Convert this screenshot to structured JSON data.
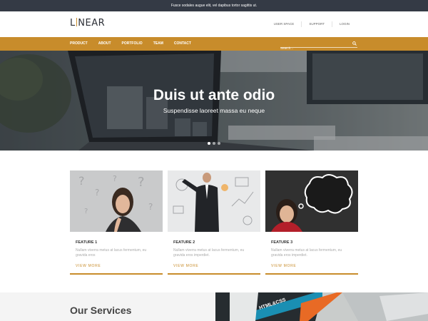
{
  "topbar": {
    "text": "Fusce sodales augue elit, vel dapibus tortor sagittis ut."
  },
  "header": {
    "logo": {
      "left": "L",
      "right": "NEAR"
    },
    "utility_links": [
      "USER SPACE",
      "SUPPORT",
      "LOGIN"
    ]
  },
  "nav": {
    "items": [
      "PRODUCT",
      "ABOUT",
      "PORTFOLIO",
      "TEAM",
      "CONTACT"
    ],
    "search_placeholder": "Search..."
  },
  "hero": {
    "title": "Duis ut ante odio",
    "subtitle": "Suspendisse laoreet massa eu neque",
    "slides": 3,
    "active_slide": 1
  },
  "features": [
    {
      "title": "FEATURE 1",
      "text": "Nullam viverra metus at lacus fermentum, eu gravida eros",
      "more": "VIEW MORE"
    },
    {
      "title": "FEATURE 2",
      "text": "Nullam viverra metus at lacus fermentum, eu gravida eros imperdiet.",
      "more": "VIEW MORE"
    },
    {
      "title": "FEATURE 3",
      "text": "Nullam viverra metus at lacus fermentum, eu gravida eros imperdiet.",
      "more": "VIEW MORE"
    }
  ],
  "services": {
    "title": "Our Services",
    "book_label": "HTML&CSS"
  },
  "colors": {
    "accent": "#c88c2b",
    "topbar": "#343a45"
  }
}
